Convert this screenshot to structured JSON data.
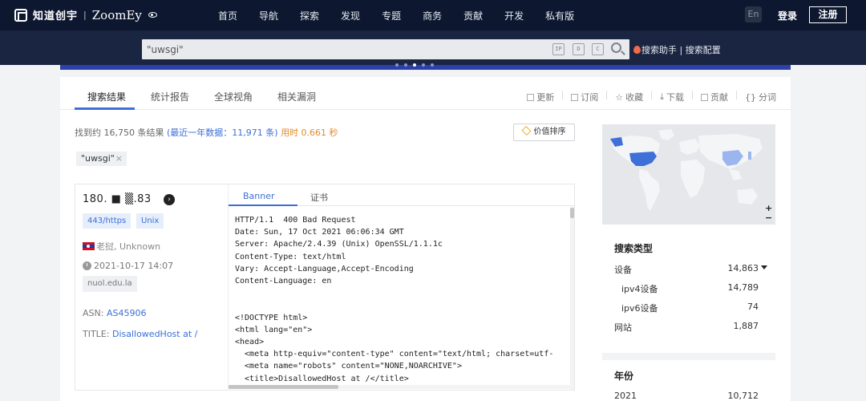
{
  "header": {
    "brand_cn": "知道创宇",
    "brand_sep": "|",
    "brand_en": "ZoomEy",
    "nav": [
      "首页",
      "导航",
      "探索",
      "发现",
      "专题",
      "商务",
      "贡献",
      "开发",
      "私有版"
    ],
    "lang": "En",
    "login": "登录",
    "register": "注册"
  },
  "search": {
    "query": "\"uwsgi\"",
    "icons": [
      "IP",
      "D",
      "C"
    ],
    "helper": "搜索助手 | 搜索配置"
  },
  "tabs": [
    "搜索结果",
    "统计报告",
    "全球视角",
    "相关漏洞"
  ],
  "actions": [
    "更新",
    "订阅",
    "收藏",
    "下载",
    "贡献",
    "分词"
  ],
  "stats": {
    "prefix": "找到约 16,750 条结果",
    "recent": "(最近一年数据：11,971 条)",
    "time": "用时 0.661 秒"
  },
  "sort_button": "价值排序",
  "filter_chip": "\"uwsgi\"",
  "result": {
    "ip": "180.    ■  ▒.83",
    "port_tag": "443/https",
    "os_tag": "Unix",
    "location": "老挝, Unknown",
    "date": "2021-10-17 14:07",
    "hostname": "nuol.edu.la",
    "asn_label": "ASN:",
    "asn_value": "AS45906",
    "title_label": "TITLE:",
    "title_value": "DisallowedHost at /",
    "panel_tabs": [
      "Banner",
      "证书"
    ],
    "banner": "HTTP/1.1  400 Bad Request\nDate: Sun, 17 Oct 2021 06:06:34 GMT\nServer: Apache/2.4.39 (Unix) OpenSSL/1.1.1c\nContent-Type: text/html\nVary: Accept-Language,Accept-Encoding\nContent-Language: en\n\n\n<!DOCTYPE html>\n<html lang=\"en\">\n<head>\n  <meta http-equiv=\"content-type\" content=\"text/html; charset=utf-\n  <meta name=\"robots\" content=\"NONE,NOARCHIVE\">\n  <title>DisallowedHost at /</title>"
  },
  "sidebar": {
    "zoom_in": "+",
    "zoom_out": "−",
    "search_type_title": "搜索类型",
    "search_type": [
      {
        "label": "设备",
        "value": "14,863"
      },
      {
        "label": "ipv4设备",
        "value": "14,789"
      },
      {
        "label": "ipv6设备",
        "value": "74"
      },
      {
        "label": "网站",
        "value": "1,887"
      }
    ],
    "year_title": "年份",
    "years": [
      {
        "label": "2021",
        "value": "10,712"
      }
    ]
  },
  "colors": {
    "nav_bg": "#0d1730",
    "accent": "#3c6fd6",
    "map_highlight": "#3f6fd8"
  }
}
